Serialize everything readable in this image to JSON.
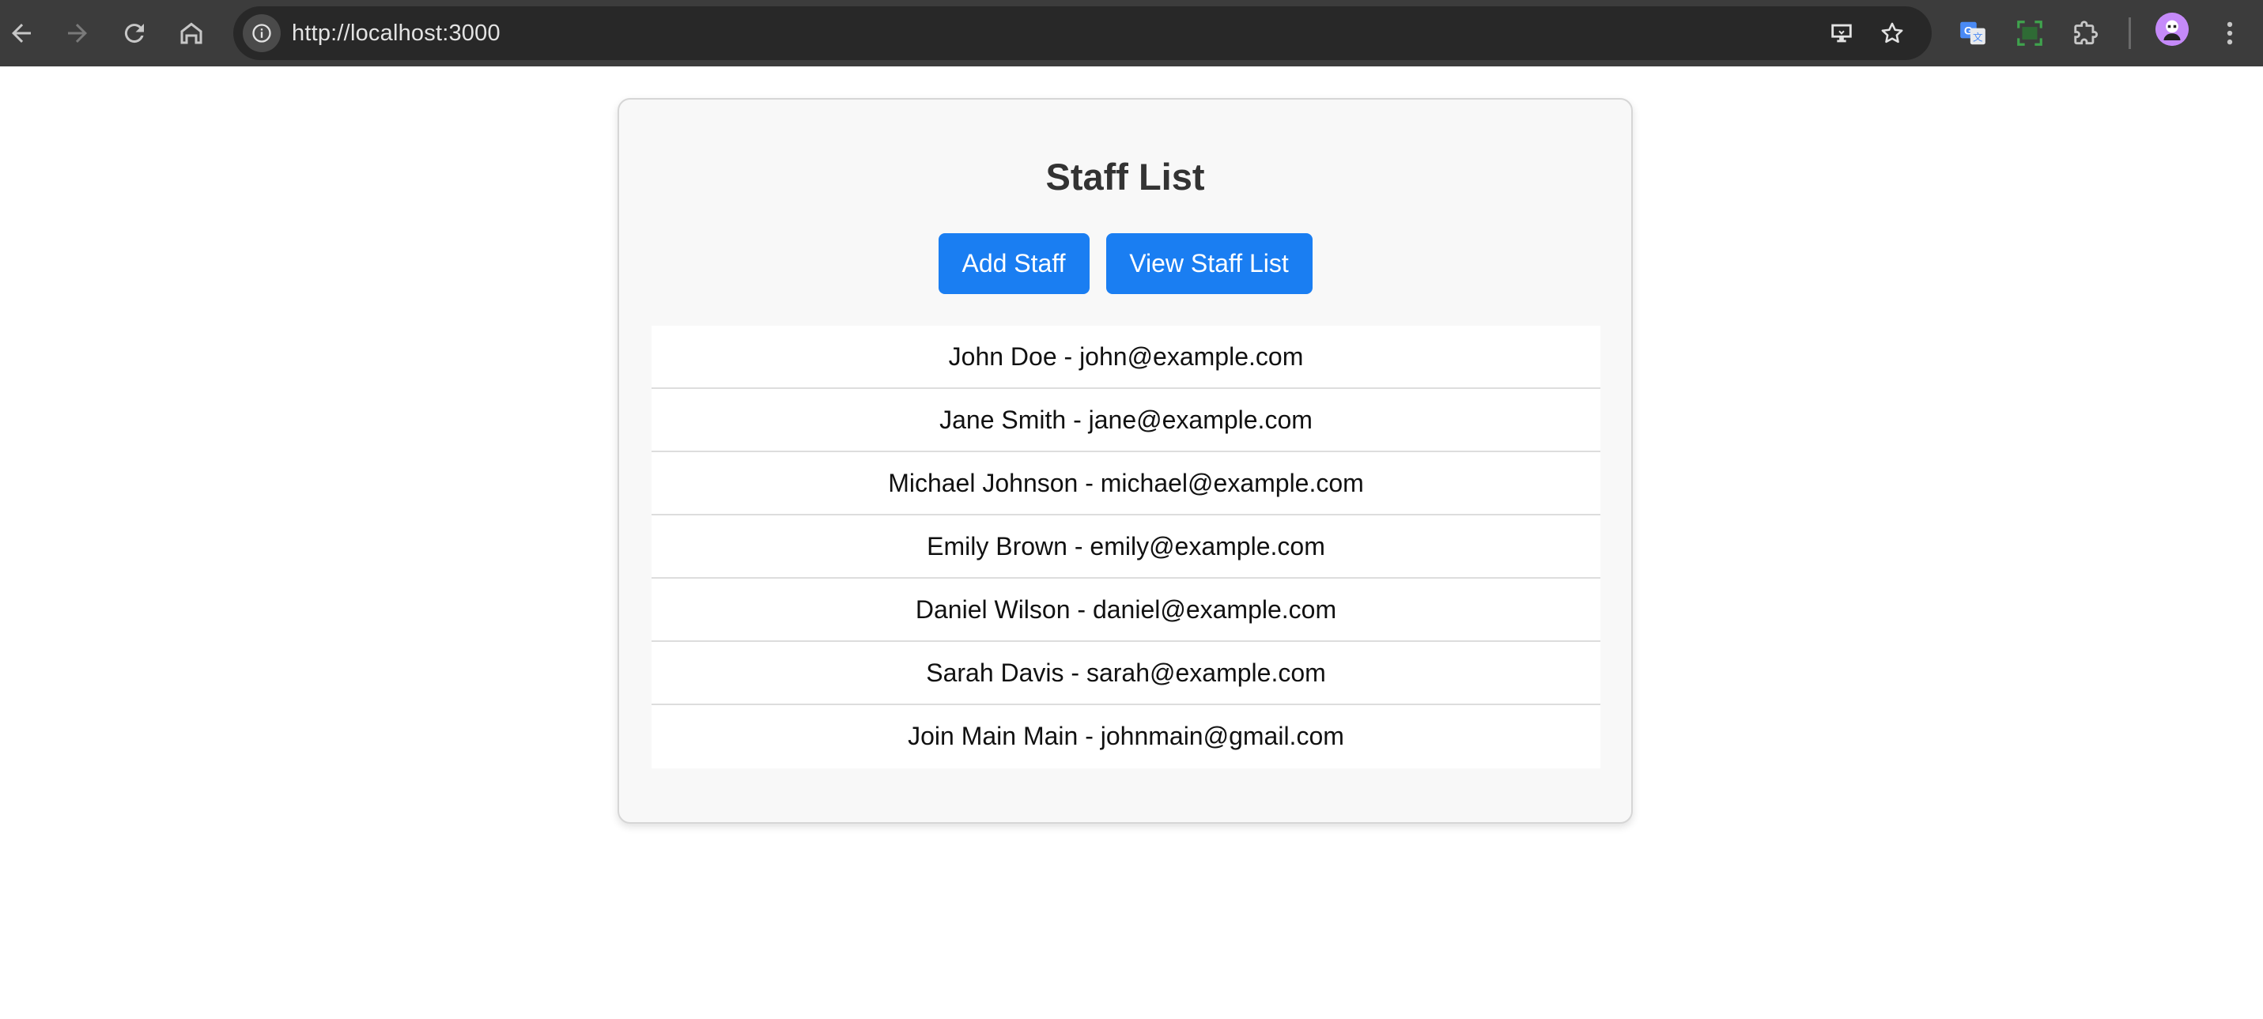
{
  "browser": {
    "url": "http://localhost:3000",
    "icons": {
      "back": "back-arrow-icon",
      "forward": "forward-arrow-icon",
      "reload": "reload-icon",
      "home": "home-icon",
      "site_info": "info-icon",
      "install": "install-app-icon",
      "bookmark": "star-icon",
      "translate": "google-translate-icon",
      "screenshot": "screenshot-icon",
      "extensions": "puzzle-icon",
      "menu": "kebab-menu-icon"
    }
  },
  "page": {
    "title": "Staff List",
    "buttons": {
      "add": "Add Staff",
      "view": "View Staff List"
    },
    "staff": [
      "John Doe - john@example.com",
      "Jane Smith - jane@example.com",
      "Michael Johnson - michael@example.com",
      "Emily Brown - emily@example.com",
      "Daniel Wilson - daniel@example.com",
      "Sarah Davis - sarah@example.com",
      "Join Main Main - johnmain@gmail.com"
    ]
  },
  "colors": {
    "accent": "#1a7ef2",
    "chrome": "#3c3c3c",
    "card_bg": "#f8f8f8"
  }
}
